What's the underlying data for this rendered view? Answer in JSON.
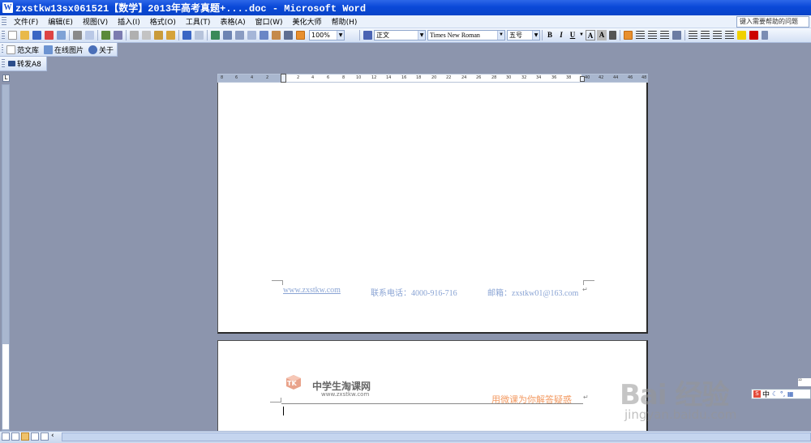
{
  "window": {
    "title": "zxstkw13sx061521【数学】2013年高考真题+....doc - Microsoft Word",
    "app_icon": "W"
  },
  "menu": [
    "文件(F)",
    "编辑(E)",
    "视图(V)",
    "插入(I)",
    "格式(O)",
    "工具(T)",
    "表格(A)",
    "窗口(W)",
    "美化大师",
    "帮助(H)"
  ],
  "help_box": {
    "placeholder": "键入需要帮助的问题"
  },
  "toolbar": {
    "zoom": "100%",
    "style": "正文",
    "font": "Times New Roman",
    "size": "五号",
    "bold": "B",
    "italic": "I",
    "underline": "U",
    "font_color_a": "A",
    "shade_a": "A"
  },
  "quick_bar": {
    "fanwen": "范文库",
    "online_images": "在线图片",
    "about": "关于",
    "forward": "转发A8"
  },
  "ruler": {
    "ticks": [
      "8",
      "6",
      "4",
      "2",
      "2",
      "4",
      "6",
      "8",
      "10",
      "12",
      "14",
      "16",
      "18",
      "20",
      "22",
      "24",
      "26",
      "28",
      "30",
      "32",
      "34",
      "36",
      "38",
      "40",
      "42",
      "44",
      "46",
      "48"
    ]
  },
  "page1_footer": {
    "website": "www.zxstkw.com",
    "phone": "联系电话：4000-916-716",
    "email": "邮箱：zxstkw01@163.com"
  },
  "page2_header": {
    "logo_mark": "TK",
    "logo_title": "中学生淘课网",
    "logo_url": "www.zxstkw.com",
    "slogan": "用微课为你解答疑惑"
  },
  "ime": {
    "label": "中",
    "marks": "☾ °, ▦"
  },
  "watermark": {
    "brand": "Bai 经验",
    "url": "jingyan.baidu.com"
  },
  "colors": {
    "titlebar": "#0a48d8",
    "footer_text": "#8aa4d4",
    "slogan": "#f39a62",
    "workspace": "#8c95ad"
  }
}
